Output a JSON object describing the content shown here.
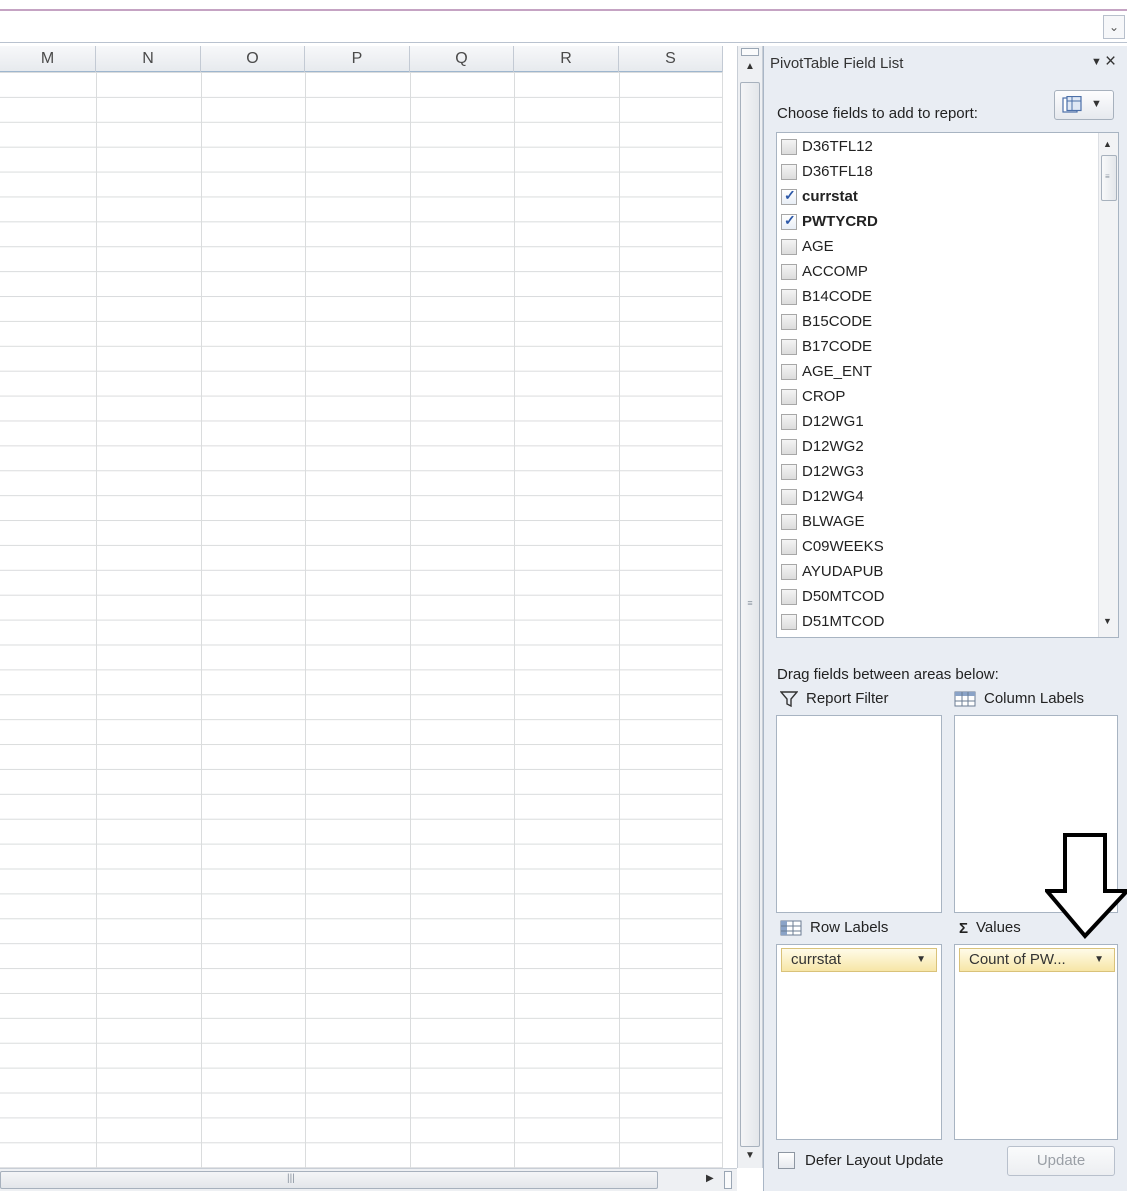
{
  "sheet": {
    "columns": [
      "M",
      "N",
      "O",
      "P",
      "Q",
      "R",
      "S"
    ]
  },
  "formula_bar": {
    "expand_icon": "chevron-down-icon"
  },
  "pivot": {
    "title": "PivotTable Field List",
    "choose_label": "Choose fields to add to report:",
    "fields": [
      {
        "label": "D36TFL12",
        "checked": false
      },
      {
        "label": "D36TFL18",
        "checked": false
      },
      {
        "label": "currstat",
        "checked": true
      },
      {
        "label": "PWTYCRD",
        "checked": true
      },
      {
        "label": "AGE",
        "checked": false
      },
      {
        "label": "ACCOMP",
        "checked": false
      },
      {
        "label": "B14CODE",
        "checked": false
      },
      {
        "label": "B15CODE",
        "checked": false
      },
      {
        "label": "B17CODE",
        "checked": false
      },
      {
        "label": "AGE_ENT",
        "checked": false
      },
      {
        "label": "CROP",
        "checked": false
      },
      {
        "label": "D12WG1",
        "checked": false
      },
      {
        "label": "D12WG2",
        "checked": false
      },
      {
        "label": "D12WG3",
        "checked": false
      },
      {
        "label": "D12WG4",
        "checked": false
      },
      {
        "label": "BLWAGE",
        "checked": false
      },
      {
        "label": "C09WEEKS",
        "checked": false
      },
      {
        "label": "AYUDAPUB",
        "checked": false
      },
      {
        "label": "D50MTCOD",
        "checked": false
      },
      {
        "label": "D51MTCOD",
        "checked": false
      }
    ],
    "drag_label": "Drag fields between areas below:",
    "areas": {
      "report_filter": {
        "label": "Report Filter"
      },
      "column_labels": {
        "label": "Column Labels"
      },
      "row_labels": {
        "label": "Row Labels",
        "item": "currstat"
      },
      "values": {
        "label": "Values",
        "item": "Count of PW..."
      }
    },
    "defer_label": "Defer Layout Update",
    "update_label": "Update",
    "values_icon": "Σ"
  }
}
